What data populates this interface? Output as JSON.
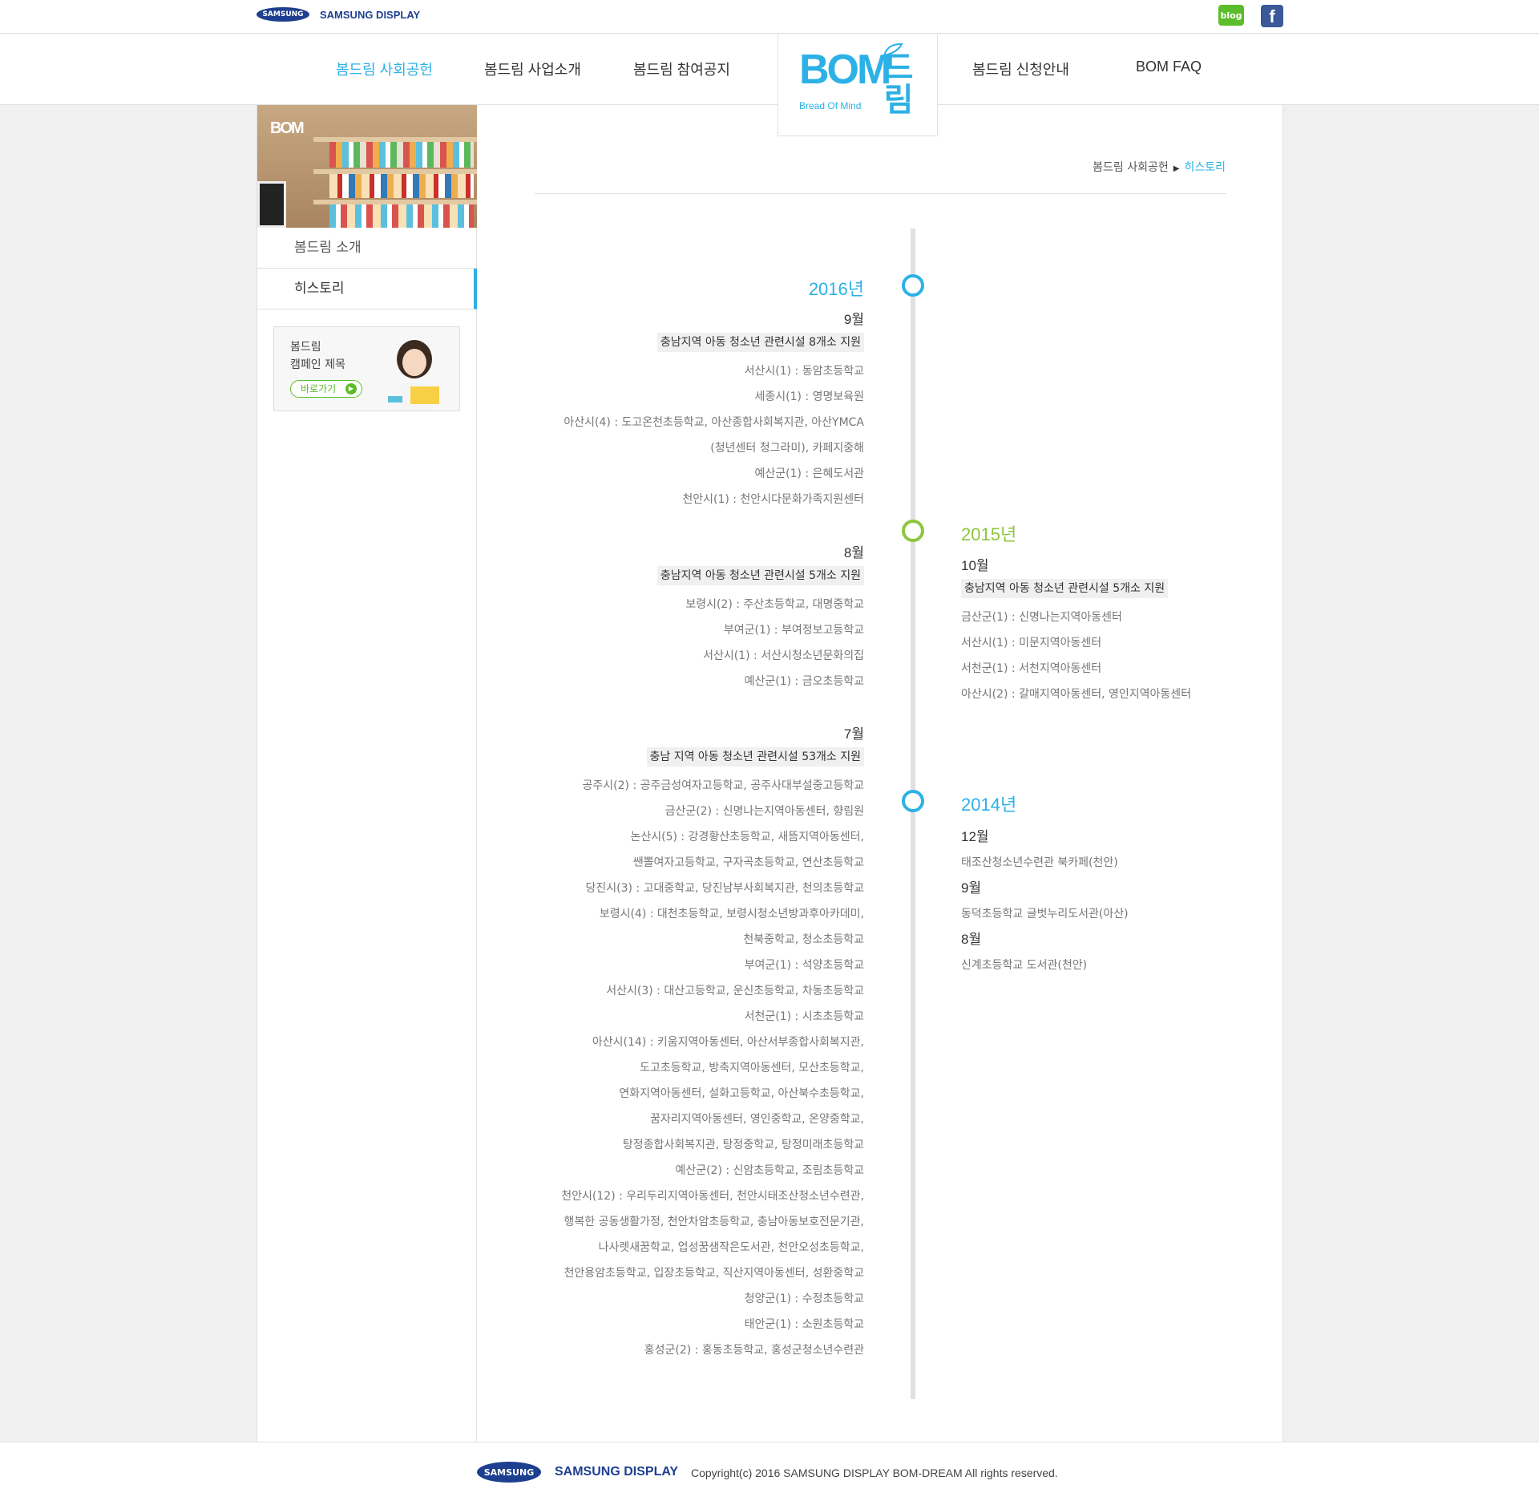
{
  "topbar": {
    "samsung_oval": "SAMSUNG",
    "samsung_display": "SAMSUNG DISPLAY",
    "blog_label": "blog",
    "facebook_label": "f"
  },
  "nav": {
    "items": [
      "봄드림 사회공헌",
      "봄드림 사업소개",
      "봄드림 참여공지",
      "봄드림 신청안내",
      "BOM FAQ"
    ],
    "active_color": "#2cb1e6"
  },
  "logo": {
    "main": "BOM",
    "sub": "Bread Of Mind",
    "dream": "드림"
  },
  "sidebar": {
    "menu": [
      "봄드림 소개",
      "히스토리"
    ],
    "campaign": {
      "line1": "봄드림",
      "line2": "캠페인 제목",
      "button": "바로가기"
    }
  },
  "breadcrumb": {
    "parent": "봄드림 사회공헌",
    "current": "히스토리"
  },
  "timeline": {
    "y2016": {
      "year": "2016년",
      "color": "#2cb1e6",
      "sep": {
        "month": "9월",
        "head": "충남지역 아동 청소년 관련시설 8개소 지원",
        "items": [
          "서산시(1) : 동암초등학교",
          "세종시(1) : 영명보육원",
          "아산시(4) : 도고온천초등학교, 아산종합사회복지관, 아산YMCA",
          "(청년센터 청그라미), 카페지중해",
          "예산군(1) : 은혜도서관",
          "천안시(1) : 천안시다문화가족지원센터"
        ]
      },
      "aug": {
        "month": "8월",
        "head": "충남지역 아동 청소년 관련시설 5개소 지원",
        "items": [
          "보령시(2) : 주산초등학교, 대명중학교",
          "부여군(1) : 부여정보고등학교",
          "서산시(1) : 서산시청소년문화의집",
          "예산군(1) : 금오초등학교"
        ]
      },
      "jul": {
        "month": "7월",
        "head": "충남 지역 아동 청소년 관련시설 53개소 지원",
        "items": [
          "공주시(2) : 공주금성여자고등학교, 공주사대부설중고등학교",
          "금산군(2) : 신명나는지역아동센터, 향림원",
          "논산시(5) : 강경황산초등학교, 새뜸지역아동센터,",
          "쌘뽈여자고등학교, 구자곡초등학교, 연산초등학교",
          "당진시(3) : 고대중학교, 당진남부사회복지관, 천의초등학교",
          "보령시(4) : 대천초등학교, 보령시청소년방과후아카데미,",
          "천북중학교, 청소초등학교",
          "부여군(1) : 석양초등학교",
          "서산시(3) : 대산고등학교, 운신초등학교, 차동초등학교",
          "서천군(1) : 시초초등학교",
          "아산시(14) : 키움지역아동센터, 아산서부종합사회복지관,",
          "도고초등학교, 방축지역아동센터, 모산초등학교,",
          "연화지역아동센터, 설화고등학교, 아산북수초등학교,",
          "꿈자리지역아동센터, 영인중학교, 온양중학교,",
          "탕정종합사회복지관, 탕정중학교, 탕정미래초등학교",
          "예산군(2) : 신암초등학교, 조림초등학교",
          "천안시(12) : 우리두리지역아동센터, 천안시태조산청소년수련관,",
          "행복한 공동생활가정, 천안차암초등학교, 충남아동보호전문기관,",
          "나사렛새꿈학교, 업성꿈샘작은도서관, 천안오성초등학교,",
          "천안용암초등학교, 입장초등학교, 직산지역아동센터, 성환중학교",
          "청양군(1) : 수정초등학교",
          "태안군(1) : 소원초등학교",
          "홍성군(2) : 홍동초등학교, 홍성군청소년수련관"
        ]
      }
    },
    "y2015": {
      "year": "2015년",
      "color": "#8dc63f",
      "oct": {
        "month": "10월",
        "head": "충남지역 아동 청소년 관련시설 5개소 지원",
        "items": [
          "금산군(1) : 신명나는지역아동센터",
          " 서산시(1) : 미문지역아동센터",
          "서천군(1) : 서천지역아동센터",
          "아산시(2) : 갈매지역아동센터, 영인지역아동센터"
        ]
      }
    },
    "y2014": {
      "year": "2014년",
      "color": "#2cb1e6",
      "entries": [
        {
          "month": "12월",
          "item": "태조산청소년수련관 북카페(천안)"
        },
        {
          "month": "9월",
          "item": "동덕초등학교 글벗누리도서관(아산)"
        },
        {
          "month": "8월",
          "item": "신계초등학교 도서관(천안)"
        }
      ]
    }
  },
  "footer": {
    "samsung_oval": "SAMSUNG",
    "samsung_display": "SAMSUNG DISPLAY",
    "copyright": "Copyright(c) 2016 SAMSUNG DISPLAY BOM-DREAM All rights reserved."
  }
}
